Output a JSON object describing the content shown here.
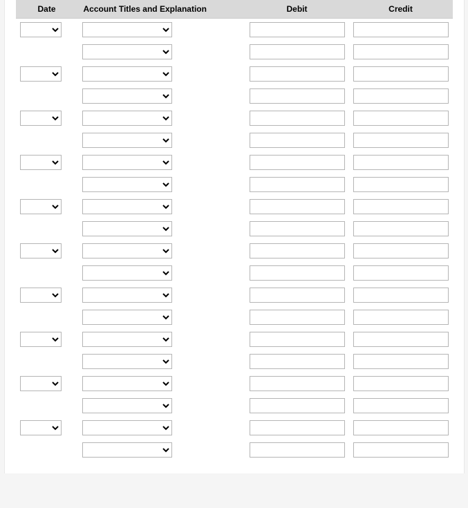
{
  "headers": {
    "date": "Date",
    "account": "Account Titles and Explanation",
    "debit": "Debit",
    "credit": "Credit"
  },
  "entries": [
    {
      "rows": [
        {
          "show_date": true,
          "date": "",
          "account": "",
          "debit": "",
          "credit": ""
        },
        {
          "show_date": false,
          "date": "",
          "account": "",
          "debit": "",
          "credit": ""
        }
      ]
    },
    {
      "rows": [
        {
          "show_date": true,
          "date": "",
          "account": "",
          "debit": "",
          "credit": ""
        },
        {
          "show_date": false,
          "date": "",
          "account": "",
          "debit": "",
          "credit": ""
        }
      ]
    },
    {
      "rows": [
        {
          "show_date": true,
          "date": "",
          "account": "",
          "debit": "",
          "credit": ""
        },
        {
          "show_date": false,
          "date": "",
          "account": "",
          "debit": "",
          "credit": ""
        }
      ]
    },
    {
      "rows": [
        {
          "show_date": true,
          "date": "",
          "account": "",
          "debit": "",
          "credit": ""
        },
        {
          "show_date": false,
          "date": "",
          "account": "",
          "debit": "",
          "credit": ""
        }
      ]
    },
    {
      "rows": [
        {
          "show_date": true,
          "date": "",
          "account": "",
          "debit": "",
          "credit": ""
        },
        {
          "show_date": false,
          "date": "",
          "account": "",
          "debit": "",
          "credit": ""
        }
      ]
    },
    {
      "rows": [
        {
          "show_date": true,
          "date": "",
          "account": "",
          "debit": "",
          "credit": ""
        },
        {
          "show_date": false,
          "date": "",
          "account": "",
          "debit": "",
          "credit": ""
        }
      ]
    },
    {
      "rows": [
        {
          "show_date": true,
          "date": "",
          "account": "",
          "debit": "",
          "credit": ""
        },
        {
          "show_date": false,
          "date": "",
          "account": "",
          "debit": "",
          "credit": ""
        }
      ]
    },
    {
      "rows": [
        {
          "show_date": true,
          "date": "",
          "account": "",
          "debit": "",
          "credit": ""
        },
        {
          "show_date": false,
          "date": "",
          "account": "",
          "debit": "",
          "credit": ""
        }
      ]
    },
    {
      "rows": [
        {
          "show_date": true,
          "date": "",
          "account": "",
          "debit": "",
          "credit": ""
        },
        {
          "show_date": false,
          "date": "",
          "account": "",
          "debit": "",
          "credit": ""
        }
      ]
    },
    {
      "rows": [
        {
          "show_date": true,
          "date": "",
          "account": "",
          "debit": "",
          "credit": ""
        },
        {
          "show_date": false,
          "date": "",
          "account": "",
          "debit": "",
          "credit": ""
        }
      ]
    }
  ]
}
